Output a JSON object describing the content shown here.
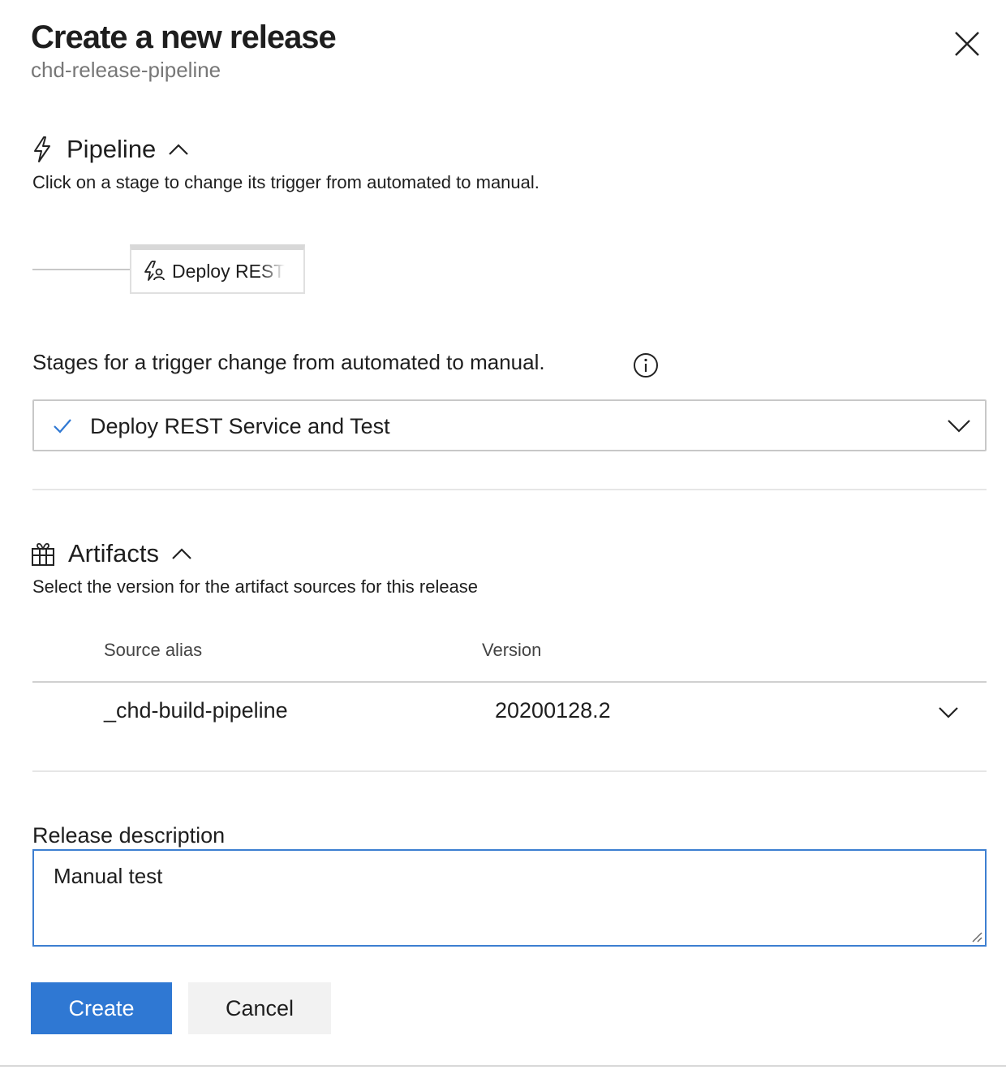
{
  "header": {
    "title": "Create a new release",
    "subtitle": "chd-release-pipeline",
    "close_icon": "close-icon"
  },
  "pipeline": {
    "icon": "lightning-icon",
    "title": "Pipeline",
    "description": "Click on a stage to change its trigger from automated to manual.",
    "stage_label": "Deploy REST",
    "stage_icon": "manual-trigger-icon",
    "stages_label": "Stages for a trigger change from automated to manual.",
    "stages_selected": "Deploy REST Service and Test"
  },
  "artifacts": {
    "icon": "gift-icon",
    "title": "Artifacts",
    "description": "Select the version for the artifact sources for this release",
    "columns": [
      "Source alias",
      "Version"
    ],
    "rows": [
      {
        "source_alias": "_chd-build-pipeline",
        "version": "20200128.2"
      }
    ]
  },
  "release_description": {
    "label": "Release description",
    "value": "Manual test"
  },
  "buttons": {
    "create": "Create",
    "cancel": "Cancel"
  },
  "colors": {
    "primary": "#2f78d3",
    "check": "#2f78d3",
    "focus_border": "#3d7fd1"
  }
}
